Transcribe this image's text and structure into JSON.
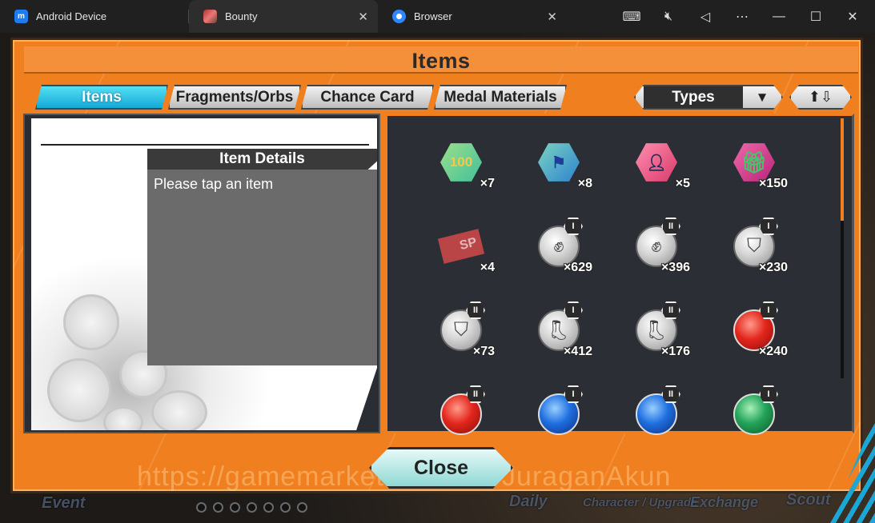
{
  "browser": {
    "tabs": [
      {
        "title": "Android Device",
        "icon": "android-device-icon"
      },
      {
        "title": "Bounty",
        "icon": "bounty-game-icon"
      },
      {
        "title": "Browser",
        "icon": "browser-icon"
      }
    ],
    "tools": [
      "keyboard-icon",
      "mute-icon",
      "back-icon",
      "more-icon",
      "minimize-icon",
      "maximize-icon",
      "close-window-icon"
    ]
  },
  "modal": {
    "title": "Items",
    "tabs": [
      "Items",
      "Fragments/Orbs",
      "Chance Card",
      "Medal Materials"
    ],
    "selected_tab": "Items",
    "filter": {
      "label": "Types",
      "icon": "dropdown-arrow-icon"
    },
    "sort_icon": "sort-up-down-icon",
    "details": {
      "heading": "Item Details",
      "text": "Please tap an item"
    },
    "items": [
      {
        "icon": "ticket-100-icon",
        "qty": "×7",
        "tier": ""
      },
      {
        "icon": "ticket-blue-flag-icon",
        "qty": "×8",
        "tier": ""
      },
      {
        "icon": "ticket-friend-icon",
        "qty": "×5",
        "tier": ""
      },
      {
        "icon": "gift-box-icon",
        "qty": "×150",
        "tier": ""
      },
      {
        "icon": "sp-ticket-icon",
        "qty": "×4",
        "tier": ""
      },
      {
        "icon": "fist-medal-icon",
        "qty": "×629",
        "tier": "I"
      },
      {
        "icon": "fist-medal-icon",
        "qty": "×396",
        "tier": "II"
      },
      {
        "icon": "shield-medal-icon",
        "qty": "×230",
        "tier": "I"
      },
      {
        "icon": "shield-medal-icon",
        "qty": "×73",
        "tier": "II"
      },
      {
        "icon": "boot-medal-icon",
        "qty": "×412",
        "tier": "I"
      },
      {
        "icon": "boot-medal-icon",
        "qty": "×176",
        "tier": "II"
      },
      {
        "icon": "red-orb-icon",
        "qty": "×240",
        "tier": "I"
      },
      {
        "icon": "red-orb-icon",
        "qty": "",
        "tier": "II"
      },
      {
        "icon": "blue-orb-icon",
        "qty": "",
        "tier": "I"
      },
      {
        "icon": "blue-orb-icon",
        "qty": "",
        "tier": "II"
      },
      {
        "icon": "green-orb-icon",
        "qty": "",
        "tier": "I"
      }
    ],
    "close_label": "Close"
  },
  "background": {
    "watermark": "https://gamemarket.id/seller/JuraganAkun",
    "nav": [
      "Event",
      "Daily",
      "Character / Upgrade",
      "Exchange",
      "Scout"
    ]
  },
  "colors": {
    "accent_orange": "#f07f1f",
    "selected_tab": "#14a8d6",
    "close_button": "#8fd8d4"
  }
}
